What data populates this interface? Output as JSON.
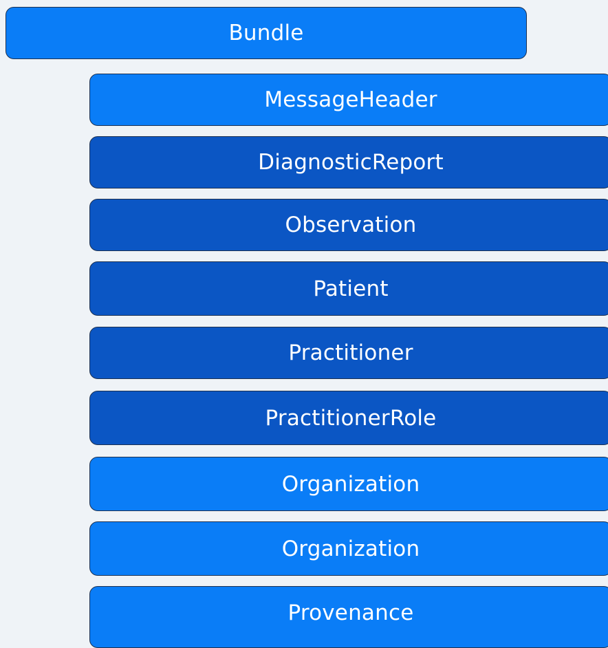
{
  "bundle": {
    "label": "Bundle"
  },
  "resources": [
    {
      "label": "MessageHeader"
    },
    {
      "label": "DiagnosticReport"
    },
    {
      "label": "Observation"
    },
    {
      "label": "Patient"
    },
    {
      "label": "Practitioner"
    },
    {
      "label": "PractitionerRole"
    },
    {
      "label": "Organization"
    },
    {
      "label": "Organization"
    },
    {
      "label": "Provenance"
    }
  ],
  "colors": {
    "background": "#eff3f7",
    "bright_box": "#0a7df7",
    "dark_box": "#0b56c4",
    "border": "#1c3050",
    "text": "#ffffff"
  }
}
